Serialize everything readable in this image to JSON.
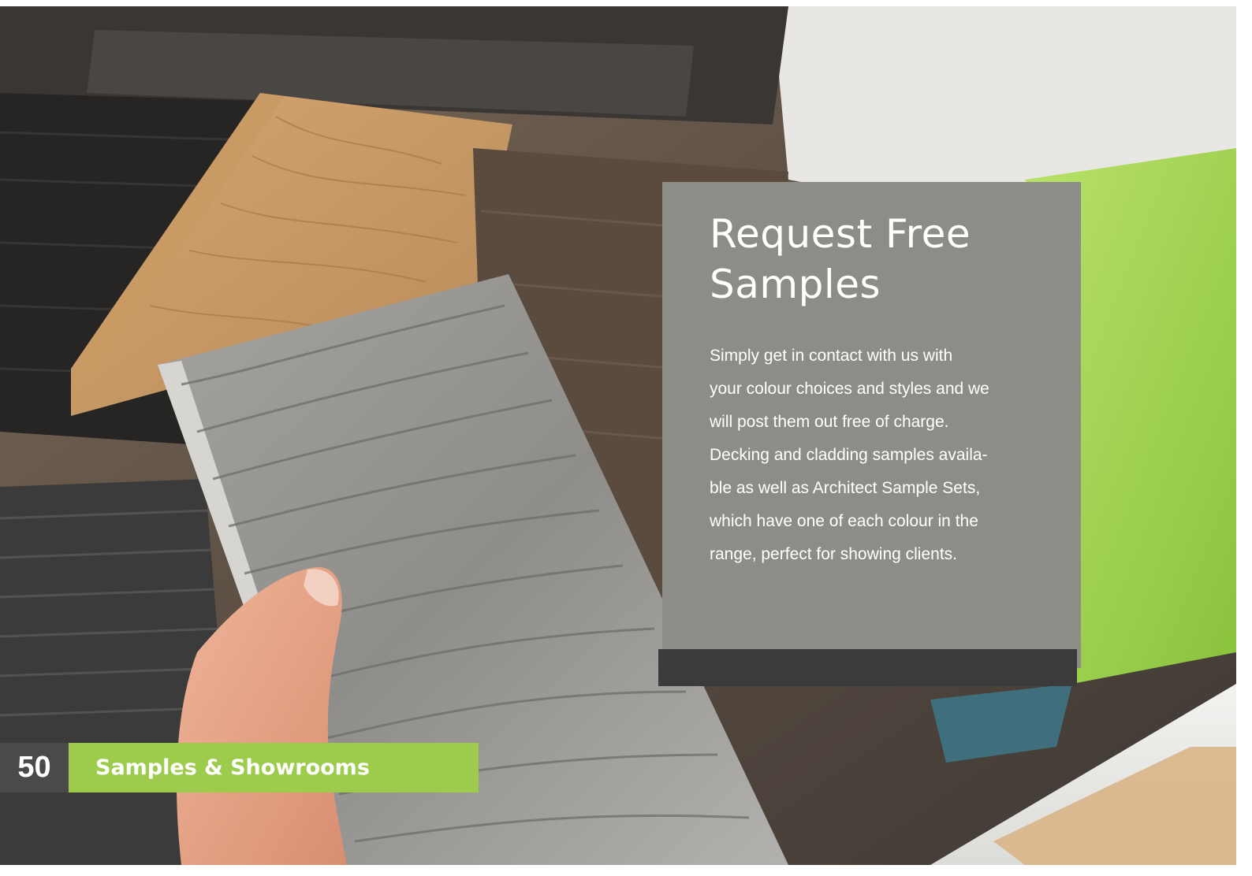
{
  "panel": {
    "title": "Request Free\nSamples",
    "body": "Simply get in contact with us with\nyour colour choices and styles and we\nwill post them out free of charge.\nDecking and cladding samples availa-\nble as well as Architect Sample Sets,\nwhich have one of each colour in the\nrange, perfect for showing clients."
  },
  "footer": {
    "page_number": "50",
    "section": "Samples & Showrooms"
  },
  "colors": {
    "panel_grey": "#8d8d87",
    "accent_green": "#9dcc4d",
    "dark_bar": "#3b3b3b",
    "page_box": "#4a4a4a"
  },
  "image": {
    "subject": "hand-holding-textured-grey-composite-sample-icon"
  }
}
